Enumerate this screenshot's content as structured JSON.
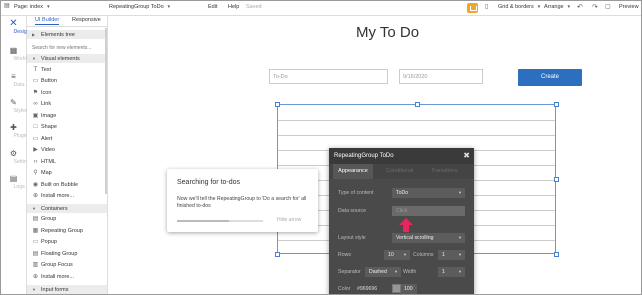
{
  "topbar": {
    "page_label": "Page: index",
    "element_name": "RepeatingGroup ToDo",
    "menu_edit": "Edit",
    "menu_help": "Help",
    "saved": "Saved",
    "grid_borders": "Grid & borders",
    "arrange": "Arrange",
    "preview": "Preview"
  },
  "leftbar": {
    "items": [
      {
        "label": "Design",
        "icon": "design-icon"
      },
      {
        "label": "Workflow",
        "icon": "workflow-icon"
      },
      {
        "label": "Data",
        "icon": "data-icon"
      },
      {
        "label": "Styles",
        "icon": "styles-icon"
      },
      {
        "label": "Plugins",
        "icon": "plugins-icon"
      },
      {
        "label": "Settings",
        "icon": "settings-icon"
      },
      {
        "label": "Logs",
        "icon": "logs-icon"
      }
    ]
  },
  "panel": {
    "tabs": [
      "UI Builder",
      "Responsive"
    ],
    "elements_tree": "Elements tree",
    "search_placeholder": "Search for new elements...",
    "visual_elements": "Visual elements",
    "visual_items": [
      "Text",
      "Button",
      "Icon",
      "Link",
      "Image",
      "Shape",
      "Alert",
      "Video",
      "HTML",
      "Map",
      "Built on Bubble",
      "Install more..."
    ],
    "containers": "Containers",
    "container_items": [
      "Group",
      "Repeating Group",
      "Popup",
      "Floating Group",
      "Group Focus",
      "Install more..."
    ],
    "input_forms": "Input forms"
  },
  "canvas": {
    "title": "My To Do",
    "todo_placeholder": "To-Do",
    "date_value": "9/16/2020",
    "create_label": "Create"
  },
  "tooltip": {
    "title": "Searching for to-dos",
    "body": "Now we'll tell the RepeatingGroup to 'Do a search for' all finished to-dos",
    "hide": "Hide arrow",
    "progress": 0.6
  },
  "editor": {
    "title": "RepeatingGroup ToDo",
    "tabs": [
      "Appearance",
      "Conditional",
      "Transitions"
    ],
    "type_label": "Type of content",
    "type_value": "ToDo",
    "source_label": "Data source",
    "source_value": "Click",
    "layout_label": "Layout style",
    "layout_value": "Vertical scrolling",
    "rows_label": "Rows",
    "rows_value": "10",
    "columns_label": "Columns",
    "columns_value": "1",
    "separator_label": "Separator",
    "separator_value": "Dashed",
    "width_label": "Width",
    "width_value": "1",
    "color_label": "Color",
    "color_value": "#969696",
    "opacity_value": "100"
  },
  "colors": {
    "accent": "#2d6fbf",
    "orange": "#f2a623",
    "pointer": "#e8265e",
    "editor_bg": "#4a4a4a"
  }
}
